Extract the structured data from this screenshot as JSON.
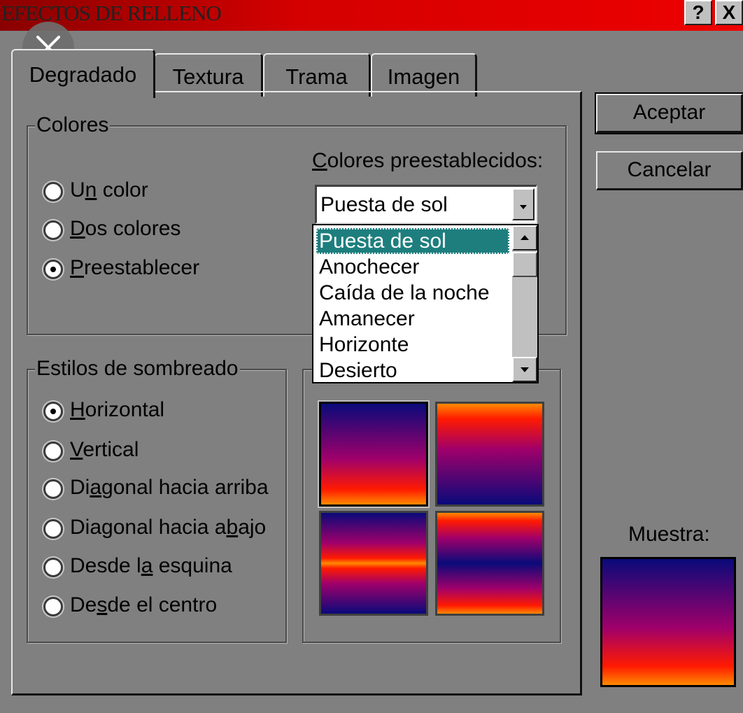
{
  "window": {
    "title": "EFECTOS DE RELLENO",
    "help_button": "?",
    "close_button": "X"
  },
  "tabs": [
    {
      "label": "Degradado",
      "active": true
    },
    {
      "label": "Textura",
      "active": false
    },
    {
      "label": "Trama",
      "active": false
    },
    {
      "label": "Imagen",
      "active": false
    }
  ],
  "colores": {
    "legend": "Colores",
    "options": [
      {
        "pre": "U",
        "key": "n",
        "post": " color",
        "checked": false
      },
      {
        "pre": "",
        "key": "D",
        "post": "os colores",
        "checked": false
      },
      {
        "pre": "",
        "key": "P",
        "post": "reestablecer",
        "checked": true
      }
    ],
    "preset_label_key": "C",
    "preset_label_rest": "olores preestablecidos:",
    "combo_value": "Puesta de sol",
    "dropdown_items": [
      "Puesta de sol",
      "Anochecer",
      "Caída de la noche",
      "Amanecer",
      "Horizonte",
      "Desierto"
    ],
    "selected_index": 0
  },
  "sombreado": {
    "legend": "Estilos de sombreado",
    "options": [
      {
        "pre": "",
        "key": "H",
        "post": "orizontal",
        "checked": true
      },
      {
        "pre": "",
        "key": "V",
        "post": "ertical",
        "checked": false
      },
      {
        "pre": "Di",
        "key": "a",
        "post": "gonal hacia arriba",
        "checked": false
      },
      {
        "pre": "Diagonal hacia a",
        "key": "b",
        "post": "ajo",
        "checked": false
      },
      {
        "pre": "Desde l",
        "key": "a",
        "post": " esquina",
        "checked": false
      },
      {
        "pre": "De",
        "key": "s",
        "post": "de el centro",
        "checked": false
      }
    ]
  },
  "variants": {
    "selected_index": 0,
    "colors": {
      "dark_blue": "#0a0a7a",
      "magenta": "#a0006a",
      "red": "#ff1a00",
      "orange": "#ff8a00"
    }
  },
  "buttons": {
    "accept": "Aceptar",
    "cancel": "Cancelar"
  },
  "sample": {
    "label": "Muestra:"
  },
  "overlay": {
    "close_icon": "close-icon"
  }
}
